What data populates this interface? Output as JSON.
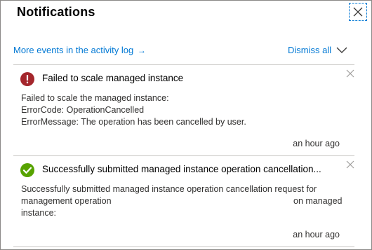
{
  "panel": {
    "title": "Notifications",
    "close_icon": "close-icon"
  },
  "toolbar": {
    "activity_link": "More events in the activity log",
    "activity_arrow": "→",
    "dismiss_all": "Dismiss all",
    "chevron_icon": "chevron-down-icon"
  },
  "notifications": [
    {
      "status": "error",
      "status_color": "#a4262c",
      "icon": "error-icon",
      "title": "Failed to scale managed instance",
      "body_lines": [
        "Failed to scale the managed instance:",
        "ErrorCode: OperationCancelled",
        "ErrorMessage: The operation has been cancelled by user."
      ],
      "time": "an hour ago"
    },
    {
      "status": "success",
      "status_color": "#57a300",
      "icon": "success-icon",
      "title": "Successfully submitted managed instance operation cancellation...",
      "body_lines": [
        "Successfully submitted managed instance operation cancellation request for",
        "management operation",
        "on managed",
        "instance:"
      ],
      "time": "an hour ago"
    }
  ],
  "colors": {
    "link": "#0078d4",
    "divider": "#c8c6c4",
    "border": "#8a8886"
  }
}
